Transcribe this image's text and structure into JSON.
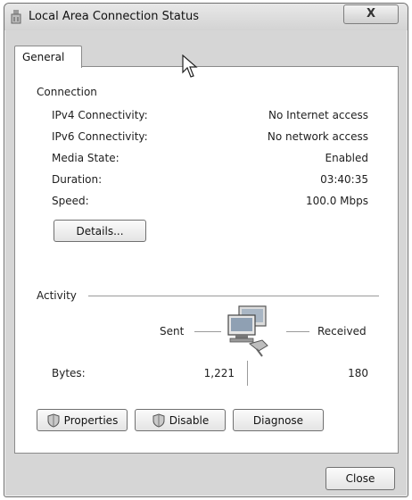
{
  "window": {
    "title": "Local Area Connection Status",
    "close_glyph": "X"
  },
  "tabs": [
    {
      "label": "General"
    }
  ],
  "connection": {
    "heading": "Connection",
    "rows": [
      {
        "label": "IPv4 Connectivity:",
        "value": "No Internet access"
      },
      {
        "label": "IPv6 Connectivity:",
        "value": "No network access"
      },
      {
        "label": "Media State:",
        "value": "Enabled"
      },
      {
        "label": "Duration:",
        "value": "03:40:35"
      },
      {
        "label": "Speed:",
        "value": "100.0 Mbps"
      }
    ],
    "details_label": "Details..."
  },
  "activity": {
    "heading": "Activity",
    "sent_label": "Sent",
    "received_label": "Received",
    "bytes_label": "Bytes:",
    "bytes_sent": "1,221",
    "bytes_received": "180"
  },
  "buttons": {
    "properties": "Properties",
    "disable": "Disable",
    "diagnose": "Diagnose",
    "close": "Close"
  },
  "icons": {
    "window_icon": "network-adapter-icon",
    "activity_icon": "network-computers-icon",
    "shield_icon": "uac-shield-icon"
  },
  "colors": {
    "panel_bg": "#ffffff",
    "window_bg": "#d6d6d6",
    "border": "#8a8a8a"
  }
}
